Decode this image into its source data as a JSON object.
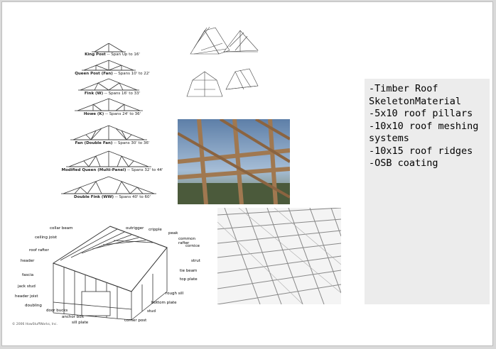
{
  "trusses": [
    {
      "name": "King Post",
      "span": "Span Up to 16'"
    },
    {
      "name": "Queen Post (Fan)",
      "span": "Spans 10' to 22'"
    },
    {
      "name": "Fink (W)",
      "span": "Spans 16' to 33'"
    },
    {
      "name": "Howe (K)",
      "span": "Spans 24' to 36'"
    },
    {
      "name": "Fan (Double Fan)",
      "span": "Spans 30' to 36'"
    },
    {
      "name": "Modified Queen (Multi-Panel)",
      "span": "Spans 32' to 44'"
    },
    {
      "name": "Double Fink (WW)",
      "span": "Spans 40' to 60'"
    }
  ],
  "framing_labels": {
    "collar_beam": "collar beam",
    "outrigger": "outrigger",
    "cripple": "cripple",
    "peak": "peak",
    "ceiling_joist": "ceiling joist",
    "common_rafter": "common rafter",
    "cornice": "cornice",
    "roof_rafter": "roof rafter",
    "header": "header",
    "strut": "strut",
    "fascia": "fascia",
    "tie_beam": "tie beam",
    "jack_stud": "jack stud",
    "top_plate": "top plate",
    "header_joist": "header joist",
    "rough_sill": "rough sill",
    "doubling": "doubling",
    "bottom_plate": "bottom plate",
    "door_bucks": "door bucks",
    "stud": "stud",
    "anchor_bolt": "anchor bolt",
    "corner_post": "corner post",
    "sill_plate": "sill plate",
    "copyright": "© 2006 HowStuffWorks, Inc."
  },
  "notes": {
    "line1": "-Timber Roof SkeletonMaterial",
    "line2": "-5x10 roof pillars",
    "line3": "-10x10 roof meshing systems",
    "line4": "-10x15 roof ridges",
    "line5": "-OSB coating"
  }
}
